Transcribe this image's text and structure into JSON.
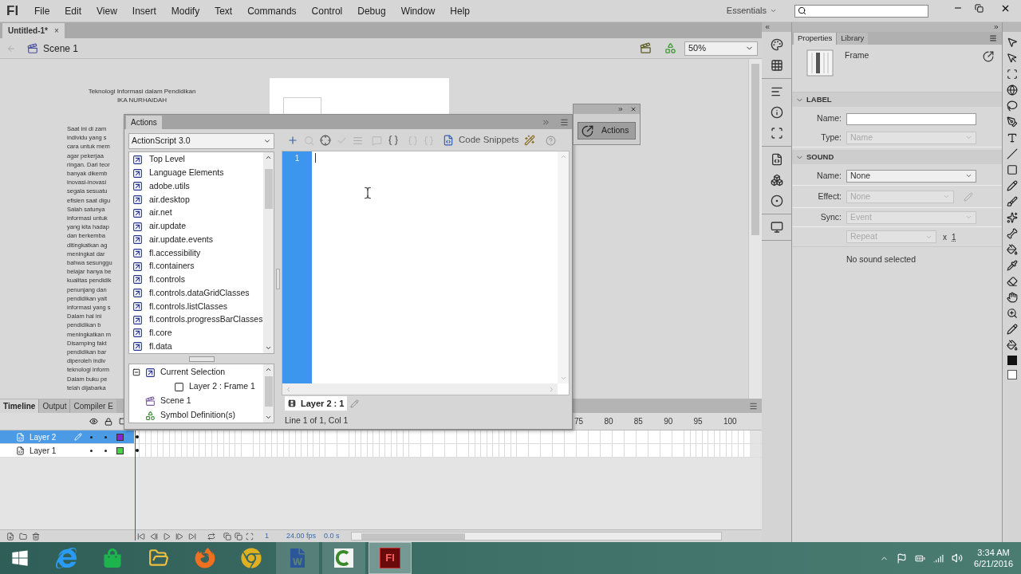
{
  "menu_bar": {
    "logo": "Fl",
    "menus": [
      "File",
      "Edit",
      "View",
      "Insert",
      "Modify",
      "Text",
      "Commands",
      "Control",
      "Debug",
      "Window",
      "Help"
    ],
    "workspace": "Essentials"
  },
  "document_tab": {
    "title": "Untitled-1*",
    "close": "×"
  },
  "edit_bar": {
    "scene": "Scene 1",
    "zoom": "50%"
  },
  "stage": {
    "title": "Teknologi Informasi dalam Pendidikan",
    "author": "IKA NURHAIDAH",
    "lines": [
      "Saat ini di zam",
      "individu yang s",
      "cara untuk mem",
      "agar pekerjaa",
      "ringan. Dari teor",
      "banyak dikemb",
      "inovasi-inovasi",
      "segala sesuatu",
      "efisien saat digu",
      "Salah satunya",
      "informasi untuk",
      "yang kita hadap",
      "dan berkemba",
      "ditingkatkan ag",
      "meningkat dar",
      "bahwa sesunggu",
      "belajar hanya be",
      "kualitas pendidik",
      "penunjang dan",
      "pendidikan yait",
      "informasi yang s",
      "Dalam hal ini",
      "pendidikan b",
      "meningkatkan m",
      "Disamping fakt",
      "pendidikan bar",
      "diperoleh indiv",
      "teknologi inform",
      "Dalam buku pe",
      "telah dijabarka"
    ]
  },
  "actions_panel": {
    "title": "Actions",
    "language": "ActionScript 3.0",
    "toolbox": [
      "Top Level",
      "Language Elements",
      "adobe.utils",
      "air.desktop",
      "air.net",
      "air.update",
      "air.update.events",
      "fl.accessibility",
      "fl.containers",
      "fl.controls",
      "fl.controls.dataGridClasses",
      "fl.controls.listClasses",
      "fl.controls.progressBarClasses",
      "fl.core",
      "fl.data"
    ],
    "tree": [
      {
        "label": "Current Selection",
        "kind": "selection",
        "expanded": true,
        "children": [
          {
            "label": "Layer 2 : Frame 1",
            "kind": "frame"
          }
        ]
      },
      {
        "label": "Scene 1",
        "kind": "scene"
      },
      {
        "label": "Symbol Definition(s)",
        "kind": "symbol"
      }
    ],
    "code_snippets": "Code Snippets",
    "line_numbers": [
      "1"
    ],
    "script_tab": "Layer 2 : 1",
    "status": "Line 1 of 1, Col 1"
  },
  "actions_mini_panel": {
    "button": "Actions"
  },
  "timeline": {
    "tabs": [
      {
        "label": "Timeline",
        "selected": true
      },
      {
        "label": "Output",
        "selected": false
      },
      {
        "label": "Compiler E",
        "selected": false
      }
    ],
    "frame_numbers": [
      "75",
      "80",
      "85",
      "90",
      "95",
      "100"
    ],
    "layers": [
      {
        "name": "Layer 2",
        "selected": true,
        "color": "#8a22d6"
      },
      {
        "name": "Layer 1",
        "selected": false,
        "color": "#44d444"
      }
    ],
    "current_frame": "1",
    "fps": "24.00 fps",
    "time": "0.0 s"
  },
  "properties": {
    "tabs": [
      {
        "label": "Properties",
        "selected": true
      },
      {
        "label": "Library",
        "selected": false
      }
    ],
    "object_type": "Frame",
    "sections": [
      {
        "heading": "LABEL",
        "expanded": true,
        "rows": [
          {
            "kind": "text",
            "label": "Name:"
          },
          {
            "kind": "select",
            "label": "Type:",
            "value": "Name",
            "disabled": true
          }
        ]
      },
      {
        "heading": "SOUND",
        "expanded": true,
        "rows": [
          {
            "kind": "select",
            "label": "Name:",
            "value": "None",
            "disabled": false
          },
          {
            "kind": "select_edit",
            "label": "Effect:",
            "value": "None",
            "disabled": true
          },
          {
            "kind": "select",
            "label": "Sync:",
            "value": "Event",
            "disabled": true
          },
          {
            "kind": "repeat",
            "value": "Repeat",
            "disabled": true,
            "times": "x",
            "count": "1"
          },
          {
            "kind": "note",
            "text": "No sound selected"
          }
        ]
      }
    ]
  },
  "taskbar": {
    "apps": [
      {
        "kind": "ie",
        "running": false,
        "selected": false
      },
      {
        "kind": "store",
        "running": false,
        "selected": false
      },
      {
        "kind": "explorer",
        "running": false,
        "selected": false
      },
      {
        "kind": "firefox",
        "running": false,
        "selected": false
      },
      {
        "kind": "chrome",
        "running": false,
        "selected": false
      },
      {
        "kind": "word",
        "running": true,
        "selected": false
      },
      {
        "kind": "camtasia",
        "running": true,
        "selected": false
      },
      {
        "kind": "flash",
        "label": "Fl",
        "selected": true
      }
    ],
    "time": "3:34 AM",
    "date": "6/21/2016"
  }
}
